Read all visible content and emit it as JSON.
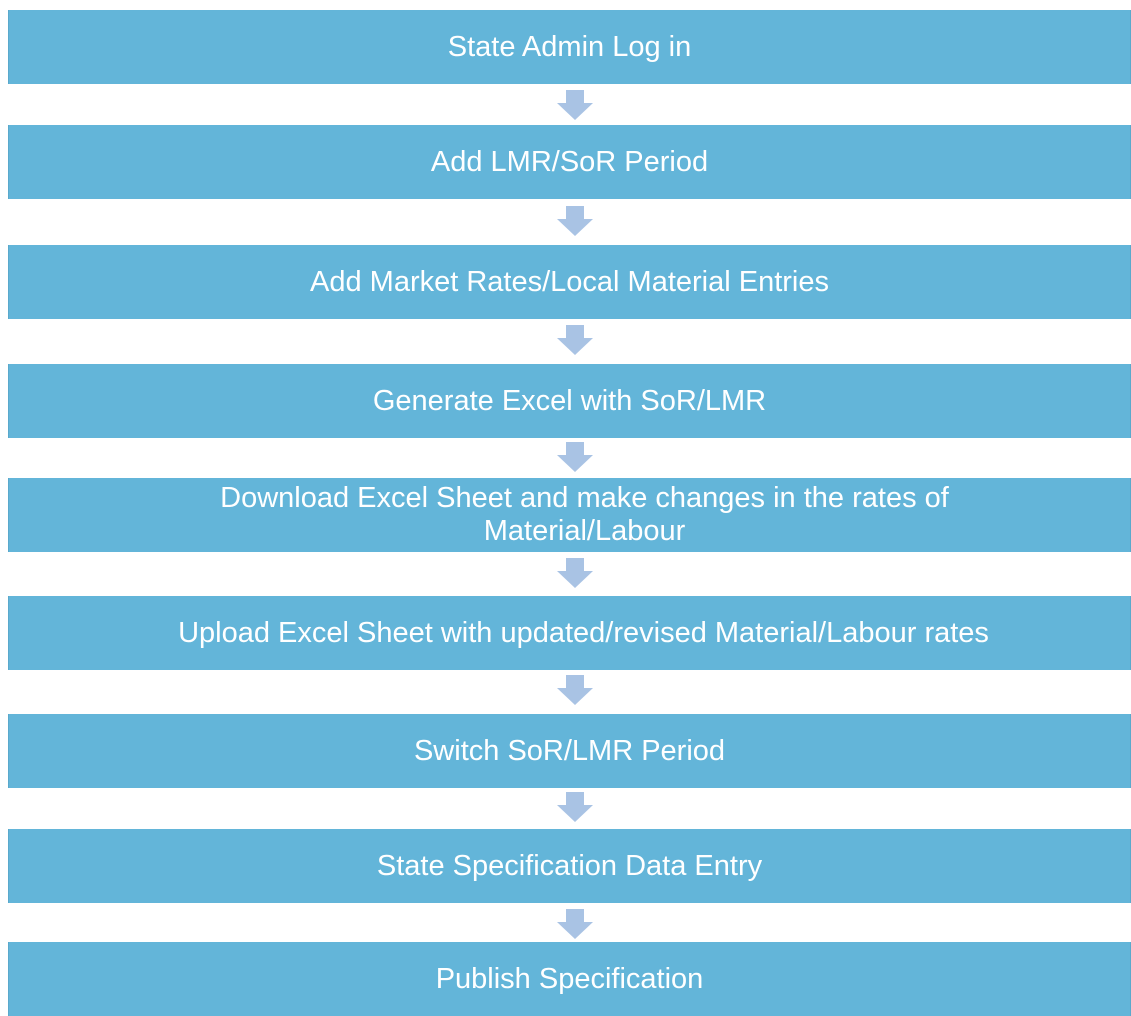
{
  "colors": {
    "box_fill": "#63b5d9",
    "arrow_fill": "#a9c3e4",
    "text": "#ffffff"
  },
  "icons": {
    "connector": "down-arrow-icon"
  },
  "steps": [
    {
      "label": "State Admin Log in"
    },
    {
      "label": "Add LMR/SoR Period"
    },
    {
      "label": "Add Market Rates/Local Material Entries"
    },
    {
      "label": "Generate Excel with SoR/LMR"
    },
    {
      "label": "Download Excel Sheet and make changes in the rates of Material/Labour"
    },
    {
      "label": "Upload Excel Sheet with updated/revised Material/Labour rates"
    },
    {
      "label": "Switch SoR/LMR Period"
    },
    {
      "label": "State Specification Data Entry"
    },
    {
      "label": "Publish Specification"
    }
  ]
}
